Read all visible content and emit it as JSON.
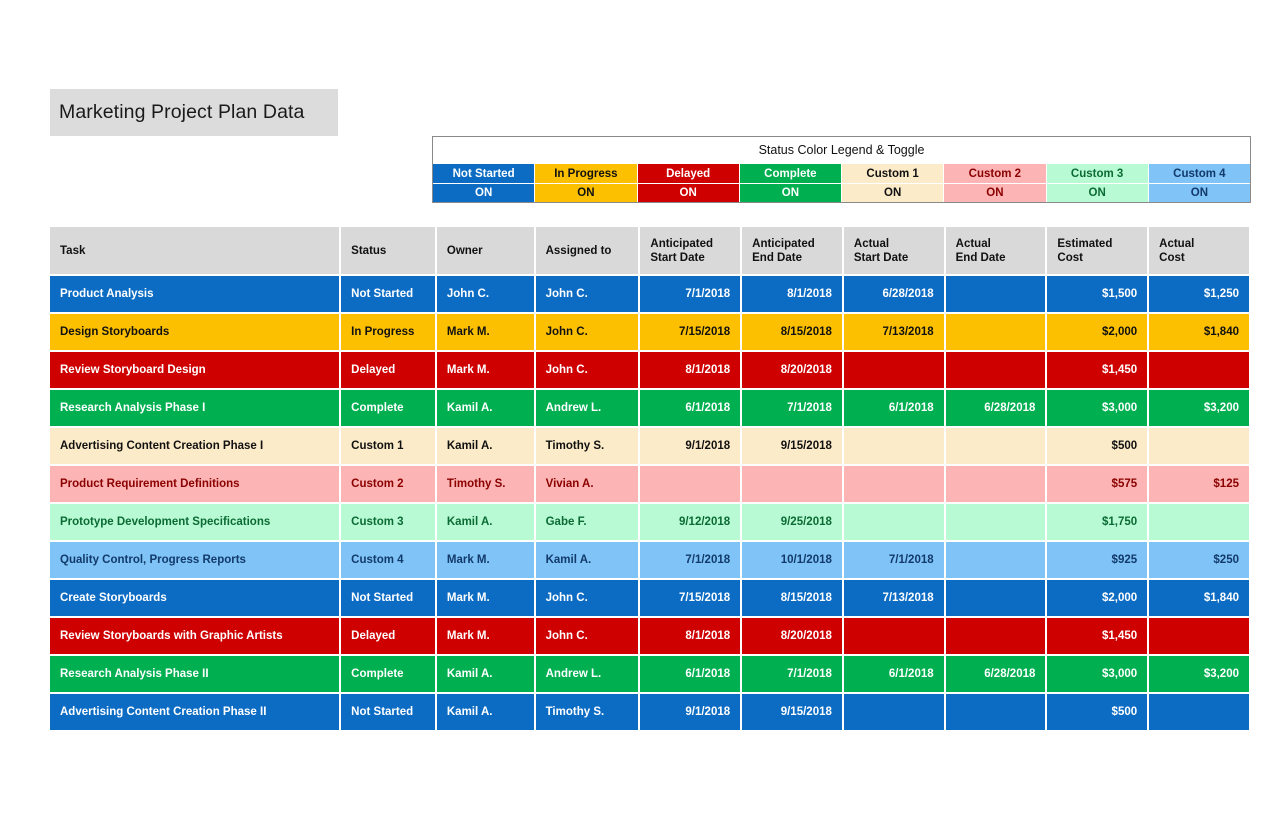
{
  "page_title": "Marketing Project Plan Data",
  "legend": {
    "title": "Status Color Legend & Toggle",
    "items": [
      {
        "label": "Not Started",
        "toggle": "ON",
        "bg": "#0C6CC4",
        "fg": "#FFFFFF"
      },
      {
        "label": "In Progress",
        "toggle": "ON",
        "bg": "#FDC000",
        "fg": "#111111"
      },
      {
        "label": "Delayed",
        "toggle": "ON",
        "bg": "#CE0000",
        "fg": "#FFFFFF"
      },
      {
        "label": "Complete",
        "toggle": "ON",
        "bg": "#00AF50",
        "fg": "#FFFFFF"
      },
      {
        "label": "Custom 1",
        "toggle": "ON",
        "bg": "#FCEBC8",
        "fg": "#111111"
      },
      {
        "label": "Custom 2",
        "toggle": "ON",
        "bg": "#FCB4B4",
        "fg": "#8B0000"
      },
      {
        "label": "Custom 3",
        "toggle": "ON",
        "bg": "#B8FAD3",
        "fg": "#0B6B35"
      },
      {
        "label": "Custom 4",
        "toggle": "ON",
        "bg": "#7FC3F7",
        "fg": "#123A6B"
      }
    ]
  },
  "table": {
    "headers": [
      {
        "line1": "Task",
        "line2": ""
      },
      {
        "line1": "Status",
        "line2": ""
      },
      {
        "line1": "Owner",
        "line2": ""
      },
      {
        "line1": "Assigned to",
        "line2": ""
      },
      {
        "line1": "Anticipated",
        "line2": "Start Date"
      },
      {
        "line1": "Anticipated",
        "line2": "End Date"
      },
      {
        "line1": "Actual",
        "line2": "Start Date"
      },
      {
        "line1": "Actual",
        "line2": "End Date"
      },
      {
        "line1": "Estimated",
        "line2": "Cost"
      },
      {
        "line1": "Actual",
        "line2": "Cost"
      }
    ],
    "header_bg": "#D9D9D9",
    "header_fg": "#111111",
    "rows": [
      {
        "task": "Product Analysis",
        "status": "Not Started",
        "owner": "John C.",
        "assigned_to": "John C.",
        "anticipated_start": "7/1/2018",
        "anticipated_end": "8/1/2018",
        "actual_start": "6/28/2018",
        "actual_end": "",
        "estimated_cost": "$1,500",
        "actual_cost": "$1,250",
        "bg": "#0C6CC4",
        "fg": "#FFFFFF"
      },
      {
        "task": "Design Storyboards",
        "status": "In Progress",
        "owner": "Mark M.",
        "assigned_to": "John C.",
        "anticipated_start": "7/15/2018",
        "anticipated_end": "8/15/2018",
        "actual_start": "7/13/2018",
        "actual_end": "",
        "estimated_cost": "$2,000",
        "actual_cost": "$1,840",
        "bg": "#FDC000",
        "fg": "#111111"
      },
      {
        "task": "Review Storyboard Design",
        "status": "Delayed",
        "owner": "Mark M.",
        "assigned_to": "John C.",
        "anticipated_start": "8/1/2018",
        "anticipated_end": "8/20/2018",
        "actual_start": "",
        "actual_end": "",
        "estimated_cost": "$1,450",
        "actual_cost": "",
        "bg": "#CE0000",
        "fg": "#FFFFFF"
      },
      {
        "task": "Research Analysis Phase I",
        "status": "Complete",
        "owner": "Kamil A.",
        "assigned_to": "Andrew L.",
        "anticipated_start": "6/1/2018",
        "anticipated_end": "7/1/2018",
        "actual_start": "6/1/2018",
        "actual_end": "6/28/2018",
        "estimated_cost": "$3,000",
        "actual_cost": "$3,200",
        "bg": "#00AF50",
        "fg": "#FFFFFF"
      },
      {
        "task": "Advertising Content Creation Phase I",
        "status": "Custom 1",
        "owner": "Kamil A.",
        "assigned_to": "Timothy S.",
        "anticipated_start": "9/1/2018",
        "anticipated_end": "9/15/2018",
        "actual_start": "",
        "actual_end": "",
        "estimated_cost": "$500",
        "actual_cost": "",
        "bg": "#FCEBC8",
        "fg": "#111111"
      },
      {
        "task": "Product Requirement Definitions",
        "status": "Custom 2",
        "owner": "Timothy S.",
        "assigned_to": "Vivian A.",
        "anticipated_start": "",
        "anticipated_end": "",
        "actual_start": "",
        "actual_end": "",
        "estimated_cost": "$575",
        "actual_cost": "$125",
        "bg": "#FCB4B4",
        "fg": "#8B0000"
      },
      {
        "task": "Prototype Development Specifications",
        "status": "Custom 3",
        "owner": "Kamil A.",
        "assigned_to": "Gabe F.",
        "anticipated_start": "9/12/2018",
        "anticipated_end": "9/25/2018",
        "actual_start": "",
        "actual_end": "",
        "estimated_cost": "$1,750",
        "actual_cost": "",
        "bg": "#B8FAD3",
        "fg": "#0B6B35"
      },
      {
        "task": "Quality Control, Progress Reports",
        "status": "Custom 4",
        "owner": "Mark M.",
        "assigned_to": "Kamil A.",
        "anticipated_start": "7/1/2018",
        "anticipated_end": "10/1/2018",
        "actual_start": "7/1/2018",
        "actual_end": "",
        "estimated_cost": "$925",
        "actual_cost": "$250",
        "bg": "#7FC3F7",
        "fg": "#123A6B"
      },
      {
        "task": "Create Storyboards",
        "status": "Not Started",
        "owner": "Mark M.",
        "assigned_to": "John C.",
        "anticipated_start": "7/15/2018",
        "anticipated_end": "8/15/2018",
        "actual_start": "7/13/2018",
        "actual_end": "",
        "estimated_cost": "$2,000",
        "actual_cost": "$1,840",
        "bg": "#0C6CC4",
        "fg": "#FFFFFF"
      },
      {
        "task": "Review Storyboards with Graphic Artists",
        "status": "Delayed",
        "owner": "Mark M.",
        "assigned_to": "John C.",
        "anticipated_start": "8/1/2018",
        "anticipated_end": "8/20/2018",
        "actual_start": "",
        "actual_end": "",
        "estimated_cost": "$1,450",
        "actual_cost": "",
        "bg": "#CE0000",
        "fg": "#FFFFFF"
      },
      {
        "task": "Research Analysis Phase II",
        "status": "Complete",
        "owner": "Kamil A.",
        "assigned_to": "Andrew L.",
        "anticipated_start": "6/1/2018",
        "anticipated_end": "7/1/2018",
        "actual_start": "6/1/2018",
        "actual_end": "6/28/2018",
        "estimated_cost": "$3,000",
        "actual_cost": "$3,200",
        "bg": "#00AF50",
        "fg": "#FFFFFF"
      },
      {
        "task": "Advertising Content Creation Phase II",
        "status": "Not Started",
        "owner": "Kamil A.",
        "assigned_to": "Timothy S.",
        "anticipated_start": "9/1/2018",
        "anticipated_end": "9/15/2018",
        "actual_start": "",
        "actual_end": "",
        "estimated_cost": "$500",
        "actual_cost": "",
        "bg": "#0C6CC4",
        "fg": "#FFFFFF"
      }
    ]
  }
}
